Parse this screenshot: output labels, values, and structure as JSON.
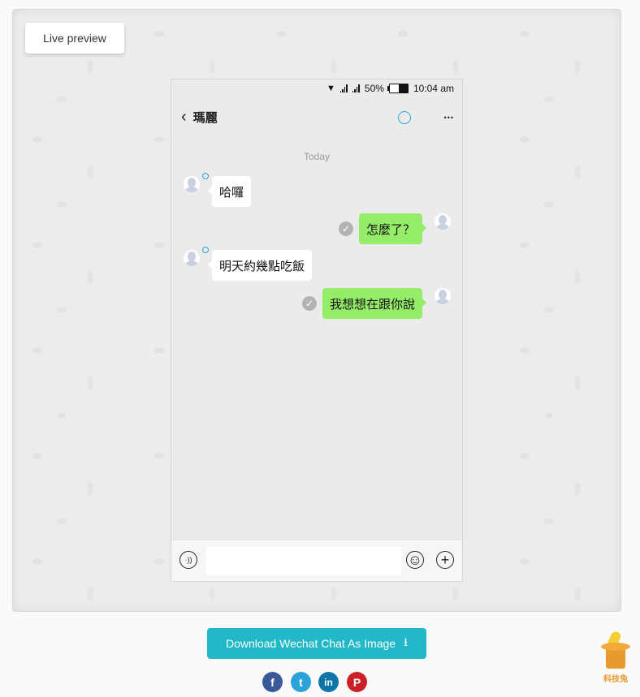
{
  "panel": {
    "live_label": "Live preview"
  },
  "phone": {
    "status": {
      "signal_icons": [
        "wifi-icon",
        "signal-icon",
        "signal-icon"
      ],
      "battery_percent": "50%",
      "battery_level": 0.5,
      "time": "10:04 am"
    },
    "nav": {
      "back_glyph": "‹",
      "contact_name": "瑪麗",
      "more_glyph": "•••"
    },
    "date_label": "Today",
    "messages": [
      {
        "side": "in",
        "text": "哈囉"
      },
      {
        "side": "out",
        "text": "怎麼了？"
      },
      {
        "side": "in",
        "text": "明天約幾點吃飯"
      },
      {
        "side": "out",
        "text": "我想想在跟你說"
      }
    ],
    "check_glyph": "✓",
    "input": {
      "value": "",
      "placeholder": ""
    },
    "icons": {
      "voice": "·))",
      "emoji": "☺",
      "plus": "+"
    }
  },
  "download": {
    "label": "Download Wechat Chat As Image",
    "icon": "⭳"
  },
  "social": [
    {
      "name": "facebook",
      "glyph": "f",
      "color": "#3b5998"
    },
    {
      "name": "twitter",
      "glyph": "t",
      "color": "#2aa3d8"
    },
    {
      "name": "linkedin",
      "glyph": "in",
      "color": "#0e76a8"
    },
    {
      "name": "pinterest",
      "glyph": "P",
      "color": "#cb2027"
    }
  ],
  "brand": {
    "name": "科技兔"
  }
}
